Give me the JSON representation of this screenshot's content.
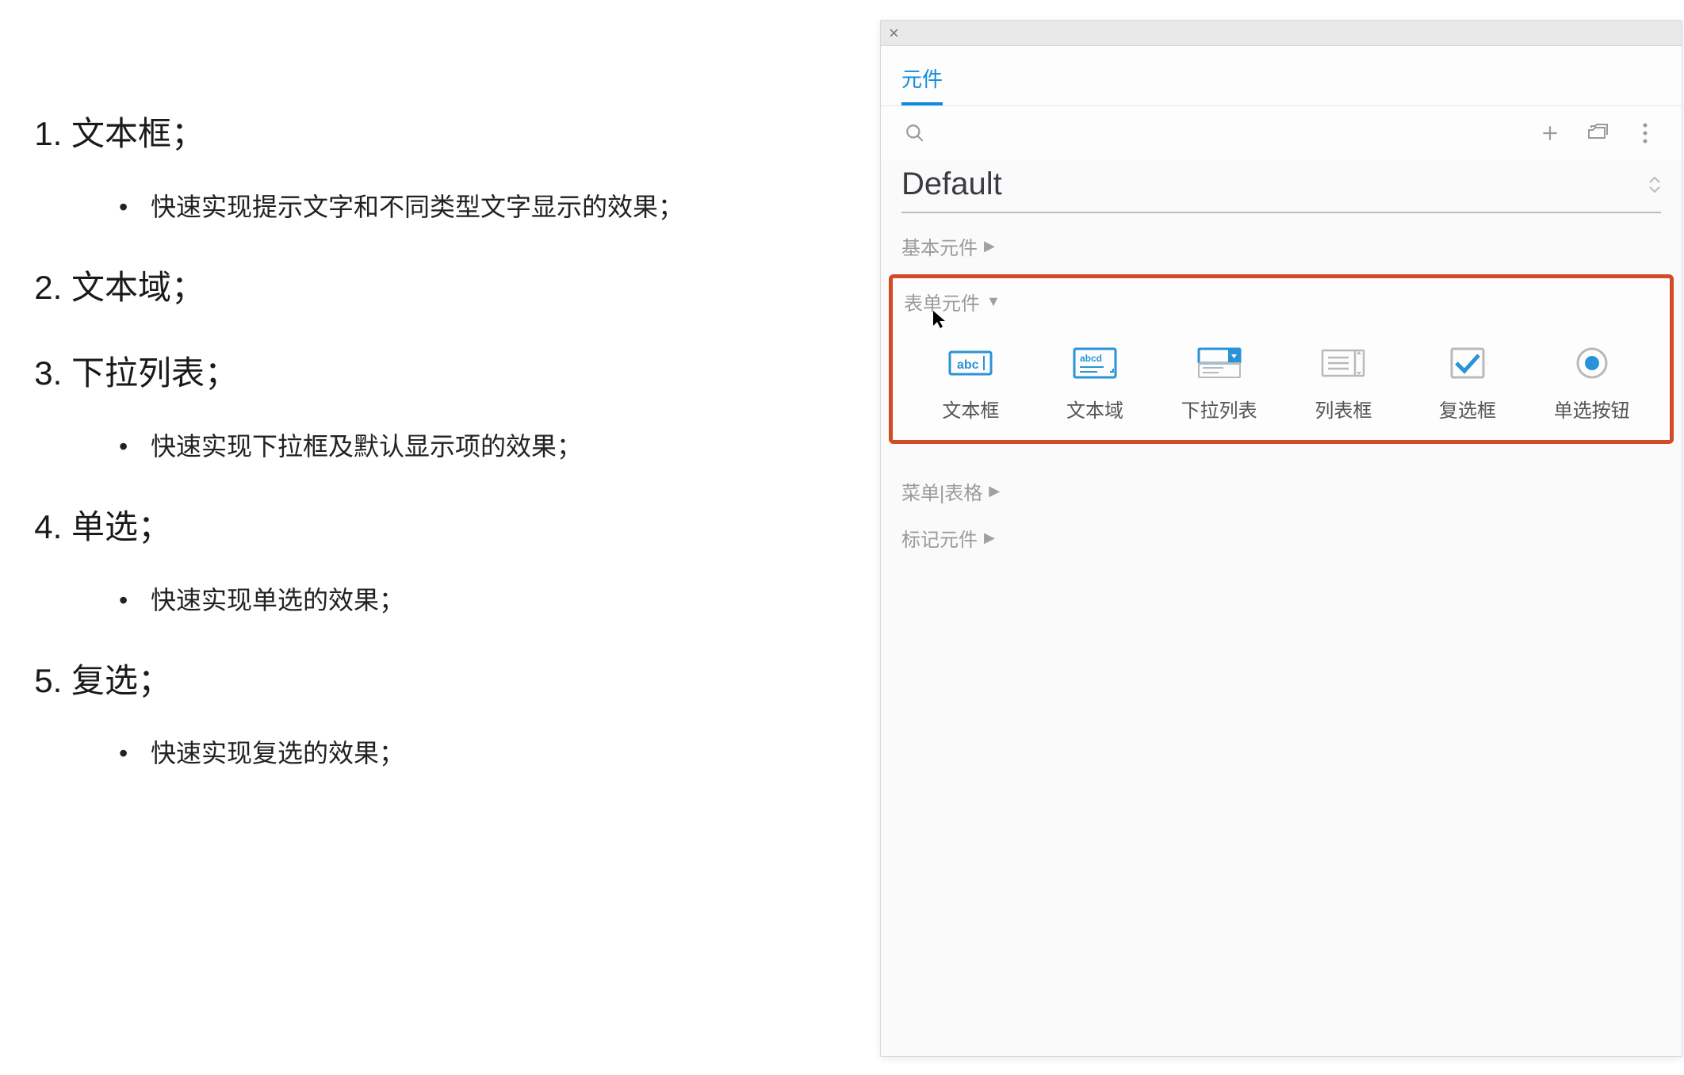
{
  "slide": {
    "items": [
      {
        "num_text": "文本框；",
        "bullets": [
          "快速实现提示文字和不同类型文字显示的效果；"
        ]
      },
      {
        "num_text": "文本域；",
        "bullets": []
      },
      {
        "num_text": "下拉列表；",
        "bullets": [
          "快速实现下拉框及默认显示项的效果；"
        ]
      },
      {
        "num_text": "单选；",
        "bullets": [
          "快速实现单选的效果；"
        ]
      },
      {
        "num_text": "复选；",
        "bullets": [
          "快速实现复选的效果；"
        ]
      }
    ]
  },
  "panel": {
    "tab_label": "元件",
    "library_name": "Default",
    "sections": {
      "basic": "基本元件",
      "form": "表单元件",
      "menu": "菜单|表格",
      "marker": "标记元件"
    },
    "widgets": [
      {
        "key": "text-field",
        "label": "文本框"
      },
      {
        "key": "text-area",
        "label": "文本域"
      },
      {
        "key": "droplist",
        "label": "下拉列表"
      },
      {
        "key": "list-box",
        "label": "列表框"
      },
      {
        "key": "checkbox",
        "label": "复选框"
      },
      {
        "key": "radio-button",
        "label": "单选按钮"
      }
    ],
    "colors": {
      "accent": "#0f8cdc",
      "highlight_border": "#d34b26"
    }
  }
}
